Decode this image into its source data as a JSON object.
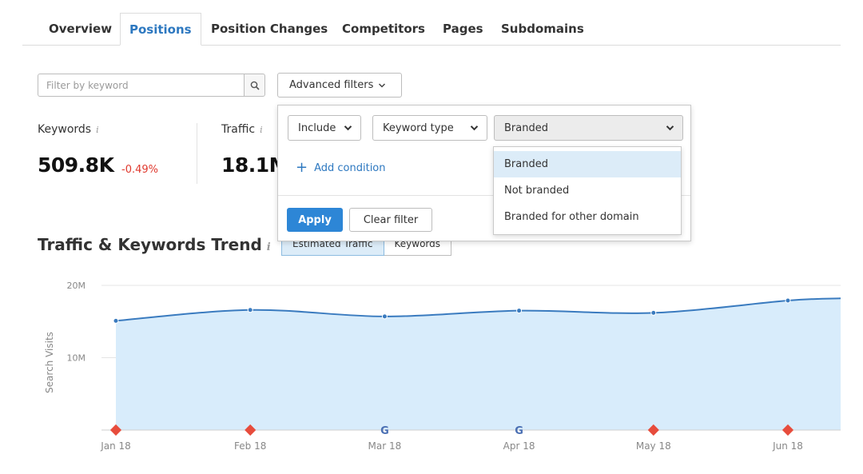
{
  "tabs": [
    {
      "label": "Overview",
      "active": false
    },
    {
      "label": "Positions",
      "active": true
    },
    {
      "label": "Position Changes",
      "active": false
    },
    {
      "label": "Competitors",
      "active": false
    },
    {
      "label": "Pages",
      "active": false
    },
    {
      "label": "Subdomains",
      "active": false
    }
  ],
  "filter": {
    "keyword_placeholder": "Filter by keyword",
    "search_icon": "search-icon",
    "advanced_label": "Advanced filters"
  },
  "summary": {
    "keywords": {
      "label": "Keywords",
      "value": "509.8K",
      "delta": "-0.49%"
    },
    "traffic": {
      "label": "Traffic",
      "value": "18.1M"
    }
  },
  "popup": {
    "include_label": "Include",
    "type_label": "Keyword type",
    "value_label": "Branded",
    "add_condition": "Add condition",
    "apply": "Apply",
    "clear": "Clear filter",
    "options": [
      {
        "label": "Branded",
        "selected": true
      },
      {
        "label": "Not branded",
        "selected": false
      },
      {
        "label": "Branded for other domain",
        "selected": false
      }
    ]
  },
  "trend": {
    "title": "Traffic & Keywords Trend",
    "toggle": [
      "Estimated Traffic",
      "Keywords"
    ],
    "active_toggle": 0
  },
  "colors": {
    "accent": "#2d78c0",
    "line": "#3a7bbf",
    "area": "#d8ecfb",
    "negative": "#e03a2f",
    "marker_red": "#e74c3c"
  },
  "chart_data": {
    "type": "area",
    "ylabel": "Search Visits",
    "ylim": [
      0,
      20000000
    ],
    "y_ticks": [
      {
        "value": 10000000,
        "label": "10M"
      },
      {
        "value": 20000000,
        "label": "20M"
      }
    ],
    "grid": true,
    "categories": [
      "Jan 18",
      "Feb 18",
      "Mar 18",
      "Apr 18",
      "May 18",
      "Jun 18"
    ],
    "series": [
      {
        "values": [
          15100000,
          16600000,
          15700000,
          16500000,
          16200000,
          17900000,
          18200000
        ]
      }
    ],
    "event_markers": [
      {
        "category": "Jan 18",
        "type": "red-diamond"
      },
      {
        "category": "Feb 18",
        "type": "red-diamond"
      },
      {
        "category": "Mar 18",
        "type": "google-update",
        "label": "G"
      },
      {
        "category": "Apr 18",
        "type": "google-update",
        "label": "G"
      },
      {
        "category": "May 18",
        "type": "red-diamond"
      },
      {
        "category": "Jun 18",
        "type": "red-diamond"
      }
    ]
  }
}
